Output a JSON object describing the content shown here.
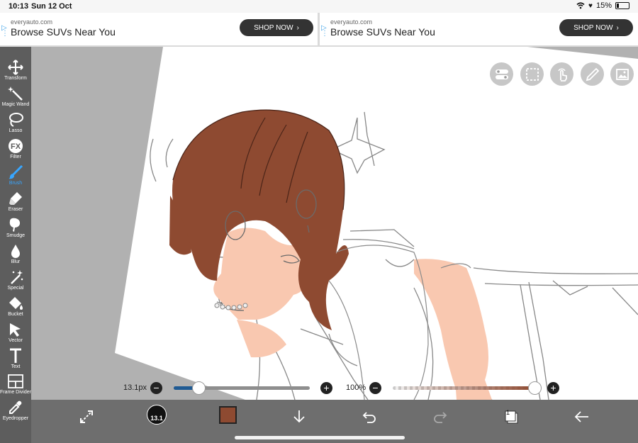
{
  "status_bar": {
    "time": "10:13",
    "date": "Sun 12 Oct",
    "battery": "15%"
  },
  "ads": [
    {
      "domain": "everyauto.com",
      "title": "Browse SUVs Near You",
      "button": "SHOP NOW"
    },
    {
      "domain": "everyauto.com",
      "title": "Browse SUVs Near You",
      "button": "SHOP NOW"
    }
  ],
  "tools": [
    {
      "label": "Transform",
      "icon": "move-icon"
    },
    {
      "label": "Magic Wand",
      "icon": "magic-wand-icon"
    },
    {
      "label": "Lasso",
      "icon": "lasso-icon"
    },
    {
      "label": "Filter",
      "icon": "fx-icon"
    },
    {
      "label": "Brush",
      "icon": "brush-icon",
      "active": true
    },
    {
      "label": "Eraser",
      "icon": "eraser-icon"
    },
    {
      "label": "Smudge",
      "icon": "smudge-icon"
    },
    {
      "label": "Blur",
      "icon": "blur-drop-icon"
    },
    {
      "label": "Special",
      "icon": "special-sparkle-icon"
    },
    {
      "label": "Bucket",
      "icon": "bucket-icon"
    },
    {
      "label": "Vector",
      "icon": "vector-arrow-icon"
    },
    {
      "label": "Text",
      "icon": "text-icon"
    },
    {
      "label": "Frame Divider",
      "icon": "frame-divider-icon"
    },
    {
      "label": "Eyedropper",
      "icon": "eyedropper-icon"
    }
  ],
  "top_buttons": [
    "layer-settings-icon",
    "selection-icon",
    "touch-icon",
    "ruler-icon",
    "image-icon"
  ],
  "brush_size": {
    "label": "13.1px",
    "fraction": 0.18
  },
  "opacity": {
    "label": "100%",
    "fraction": 1.0
  },
  "brush_preview_text": "13.1",
  "colors": {
    "current": "#8e4a31",
    "accent": "#38a6ff",
    "slider_blue": "#1f5a93"
  },
  "bottom_bar": [
    "transform-icon",
    "brush-size-preview",
    "color-swatch",
    "download-icon",
    "undo-icon",
    "redo-icon",
    "layers-icon",
    "back-icon"
  ],
  "layers_count": "1"
}
